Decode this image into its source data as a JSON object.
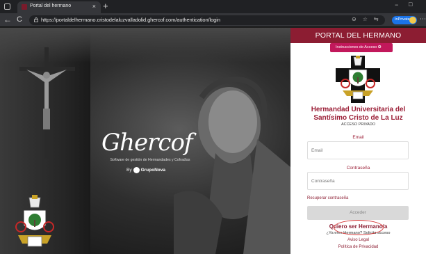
{
  "browser": {
    "tab_title": "Portal del hermano",
    "tab_close": "×",
    "new_tab": "+",
    "url": "https://portaldelhermano.cristodelaluzvalladolid.ghercof.com/authentication/login",
    "inprivate_label": "InPrivate",
    "back": "←",
    "reload": "C",
    "minimize": "−",
    "maximize": "□",
    "more": "⋯",
    "url_icons": [
      "⊖",
      "☆",
      "⇆"
    ]
  },
  "hero": {
    "logo_text": "Ghercof",
    "logo_subtitle": "Software de gestión de Hermandades y Cofradías",
    "by_label": "By",
    "company": "GrupoNova"
  },
  "panel": {
    "title": "PORTAL DEL HERMANO",
    "instructions_label": "Instrucciones de Acceso ✪",
    "brotherhood_line1": "Hermandad Universitaria del",
    "brotherhood_line2": "Santísimo Cristo de La Luz",
    "private_access": "ACCESO PRIVADO",
    "email_label": "Email",
    "email_placeholder": "Email",
    "password_label": "Contraseña",
    "password_placeholder": "Contraseña",
    "recover_password": "Recuperar contraseña",
    "access_button": "Acceder",
    "want_brother": "Quiero ser Hermano/a",
    "request_access": "¿Ya eres Hermano? Solicita acceso",
    "legal_notice": "Aviso Legal",
    "privacy_policy": "Política de Privacidad"
  },
  "colors": {
    "brand": "#8c1d32",
    "instructions": "#c2185b",
    "annotation": "#d32f2f"
  }
}
